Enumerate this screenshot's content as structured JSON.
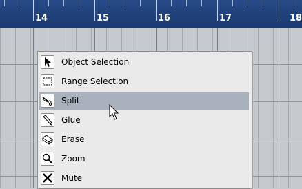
{
  "ruler": {
    "bars": [
      "14",
      "15",
      "16",
      "17",
      "18"
    ]
  },
  "toolbox": {
    "items": [
      {
        "label": "Object Selection",
        "icon": "arrow-icon"
      },
      {
        "label": "Range Selection",
        "icon": "range-select-icon"
      },
      {
        "label": "Split",
        "icon": "scissors-icon",
        "highlighted": true
      },
      {
        "label": "Glue",
        "icon": "glue-icon"
      },
      {
        "label": "Erase",
        "icon": "eraser-icon"
      },
      {
        "label": "Zoom",
        "icon": "magnifier-icon"
      },
      {
        "label": "Mute",
        "icon": "mute-x-icon"
      }
    ]
  },
  "colors": {
    "ruler_bg": "#1a3a70",
    "ruler_text": "#ffffff",
    "grid_bg": "#c6c9ce",
    "menu_bg": "#eaeaea",
    "highlight_bg": "#a9b1bc"
  }
}
